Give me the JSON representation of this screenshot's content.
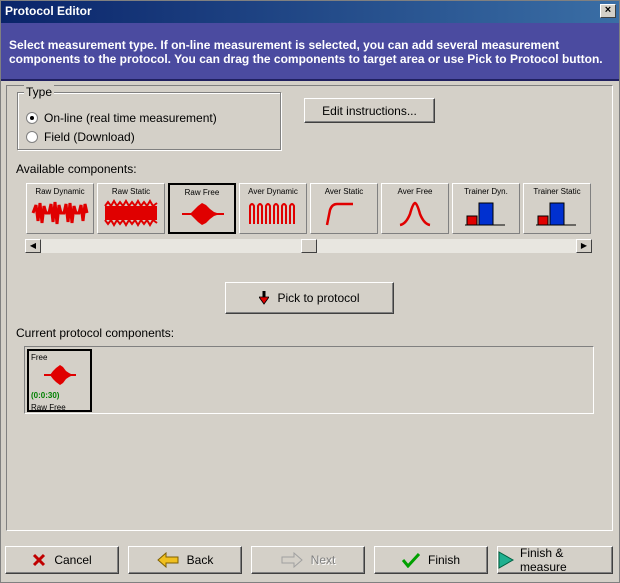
{
  "window": {
    "title": "Protocol Editor",
    "close_glyph": "×",
    "header_text": "Select measurement type. If on-line measurement is selected, you can add several measurement components to the protocol. You can drag the components to target area or use Pick to Protocol button."
  },
  "type_group": {
    "legend": "Type",
    "options": [
      {
        "label": "On-line (real time measurement)",
        "checked": true
      },
      {
        "label": "Field (Download)",
        "checked": false
      }
    ]
  },
  "edit_instructions_label": "Edit instructions...",
  "available_label": "Available components:",
  "components": [
    {
      "label": "Raw Dynamic",
      "icon": "raw-dynamic-waveform-icon"
    },
    {
      "label": "Raw Static",
      "icon": "raw-static-waveform-icon"
    },
    {
      "label": "Raw Free",
      "icon": "raw-free-waveform-icon",
      "selected": true
    },
    {
      "label": "Aver Dynamic",
      "icon": "aver-dynamic-waveform-icon"
    },
    {
      "label": "Aver Static",
      "icon": "aver-static-curve-icon"
    },
    {
      "label": "Aver Free",
      "icon": "aver-free-bell-icon"
    },
    {
      "label": "Trainer Dyn.",
      "icon": "trainer-dyn-bars-icon"
    },
    {
      "label": "Trainer Static",
      "icon": "trainer-static-bars-icon"
    }
  ],
  "scrollbar": {
    "left_glyph": "◀",
    "right_glyph": "▶"
  },
  "pick_button_label": "Pick to protocol",
  "current_label": "Current protocol components:",
  "current_components": [
    {
      "top": "Free",
      "time": "(0:0:30)",
      "bottom": "Raw Free",
      "time_color": "#008000"
    }
  ],
  "footer": {
    "cancel": "Cancel",
    "back": "Back",
    "next": "Next",
    "finish": "Finish",
    "finish_measure": "Finish & measure"
  },
  "colors": {
    "accent_red": "#e00000",
    "bar_blue": "#0030d0",
    "header_bg": "#4b4ba0",
    "time_green": "#008000"
  }
}
